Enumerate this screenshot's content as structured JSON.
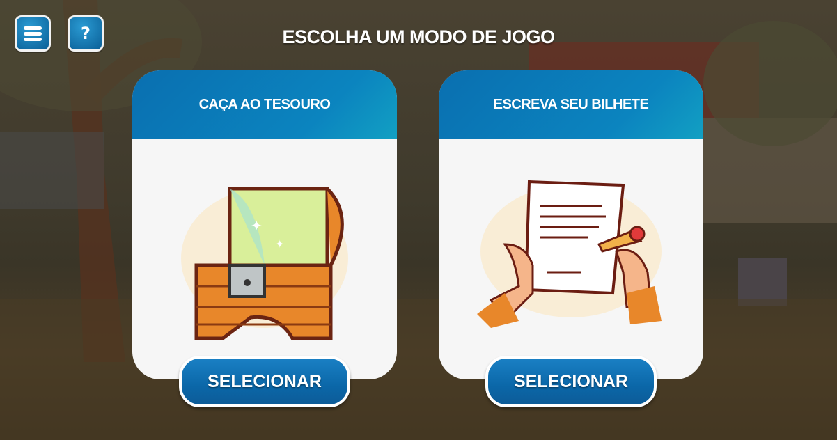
{
  "header": {
    "title": "ESCOLHA UM MODO DE JOGO",
    "menu_icon": "menu-icon",
    "help_label": "?"
  },
  "modes": [
    {
      "title": "CAÇA AO TESOURO",
      "button": "SELECIONAR",
      "icon": "treasure-chest"
    },
    {
      "title": "ESCREVA SEU BILHETE",
      "button": "SELECIONAR",
      "icon": "writing-note"
    }
  ]
}
